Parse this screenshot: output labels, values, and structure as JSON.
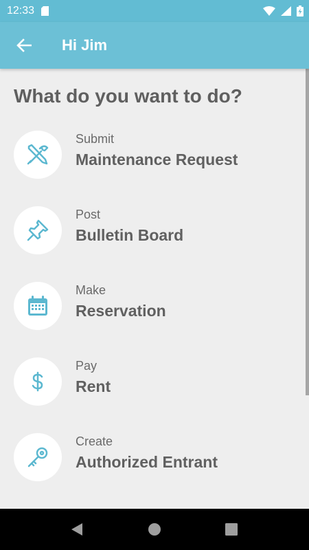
{
  "status_bar": {
    "time": "12:33",
    "icons": [
      "sd-card-icon",
      "wifi-icon",
      "cellular-signal-icon",
      "battery-charging-icon"
    ]
  },
  "app_bar": {
    "back_icon": "arrow-left-icon",
    "title": "Hi Jim"
  },
  "main": {
    "heading": "What do you want to do?",
    "actions": [
      {
        "verb": "Submit",
        "noun": "Maintenance Request",
        "icon": "tools-icon"
      },
      {
        "verb": "Post",
        "noun": "Bulletin Board",
        "icon": "pushpin-icon"
      },
      {
        "verb": "Make",
        "noun": "Reservation",
        "icon": "calendar-icon"
      },
      {
        "verb": "Pay",
        "noun": "Rent",
        "icon": "dollar-icon"
      },
      {
        "verb": "Create",
        "noun": "Authorized Entrant",
        "icon": "key-icon"
      }
    ]
  },
  "nav_bar": {
    "buttons": [
      "back-triangle-icon",
      "home-circle-icon",
      "recents-square-icon"
    ]
  },
  "colors": {
    "accent": "#6cc0d6",
    "status_bar": "#62bcd3",
    "background": "#eeeeee",
    "icon": "#5cb8d0"
  }
}
